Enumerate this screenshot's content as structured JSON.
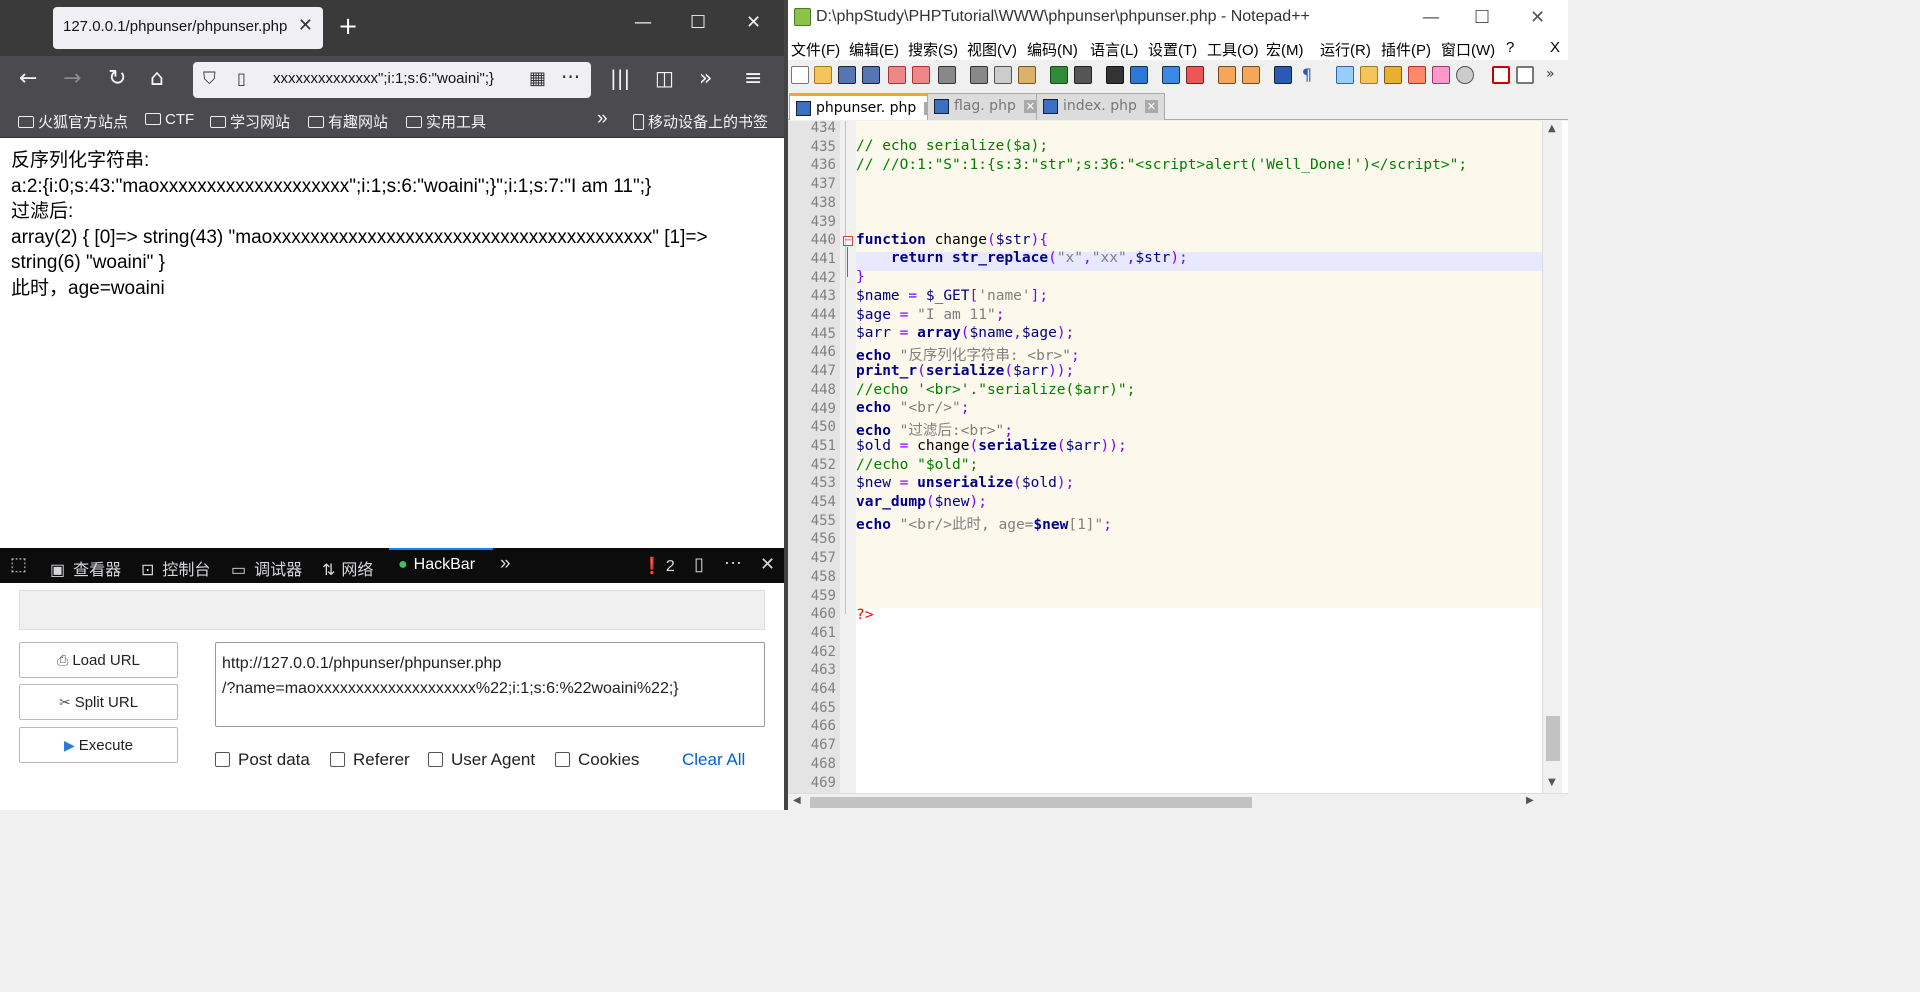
{
  "firefox": {
    "tab_title": "127.0.0.1/phpunser/phpunser.php",
    "url_display": "xxxxxxxxxxxxxx\";i:1;s:6:\"woaini\";}",
    "bookmarks": [
      "火狐官方站点",
      "CTF",
      "学习网站",
      "有趣网站",
      "实用工具"
    ],
    "mobile_bookmarks": "移动设备上的书签",
    "page_lines": [
      "反序列化字符串:",
      "a:2:{i:0;s:43:\"maoxxxxxxxxxxxxxxxxxxxx\";i:1;s:6:\"woaini\";}\";i:1;s:7:\"I am 11\";}",
      "过滤后:",
      "array(2) { [0]=> string(43) \"maoxxxxxxxxxxxxxxxxxxxxxxxxxxxxxxxxxxxxxxxx\" [1]=>",
      "string(6) \"woaini\" }",
      "此时，age=woaini"
    ],
    "devtools": {
      "tabs": [
        "查看器",
        "控制台",
        "调试器",
        "网络",
        "HackBar"
      ],
      "error_count": "2"
    },
    "hackbar": {
      "buttons": [
        "Load URL",
        "Split URL",
        "Execute"
      ],
      "url_value": "http://127.0.0.1/phpunser/phpunser.php\n/?name=maoxxxxxxxxxxxxxxxxxxxx%22;i:1;s:6:%22woaini%22;}",
      "checkboxes": [
        "Post data",
        "Referer",
        "User Agent",
        "Cookies"
      ],
      "clear_all": "Clear All"
    }
  },
  "notepad": {
    "title": "D:\\phpStudy\\PHPTutorial\\WWW\\phpunser\\phpunser.php - Notepad++",
    "menu": [
      "文件(F)",
      "编辑(E)",
      "搜索(S)",
      "视图(V)",
      "编码(N)",
      "语言(L)",
      "设置(T)",
      "工具(O)",
      "宏(M)",
      "运行(R)",
      "插件(P)",
      "窗口(W)",
      "?"
    ],
    "menu_close": "X",
    "tabs": [
      {
        "label": "phpunser. php",
        "active": true
      },
      {
        "label": "flag. php",
        "active": false
      },
      {
        "label": "index. php",
        "active": false
      }
    ],
    "line_numbers": [
      "434",
      "435",
      "436",
      "437",
      "438",
      "439",
      "440",
      "441",
      "442",
      "443",
      "444",
      "445",
      "446",
      "447",
      "448",
      "449",
      "450",
      "451",
      "452",
      "453",
      "454",
      "455",
      "456",
      "457",
      "458",
      "459",
      "460",
      "461",
      "462",
      "463",
      "464",
      "465",
      "466",
      "467",
      "468",
      "469"
    ]
  },
  "colors": {
    "ff_dark": "#4a4a4f",
    "devtools_bg": "#0c0c0d",
    "hackbar_link": "#0060df",
    "npp_comment": "#008000",
    "npp_keyword": "#00008b",
    "npp_string": "#808080",
    "npp_operator": "#8000ff",
    "npp_tag": "#ff0000"
  }
}
